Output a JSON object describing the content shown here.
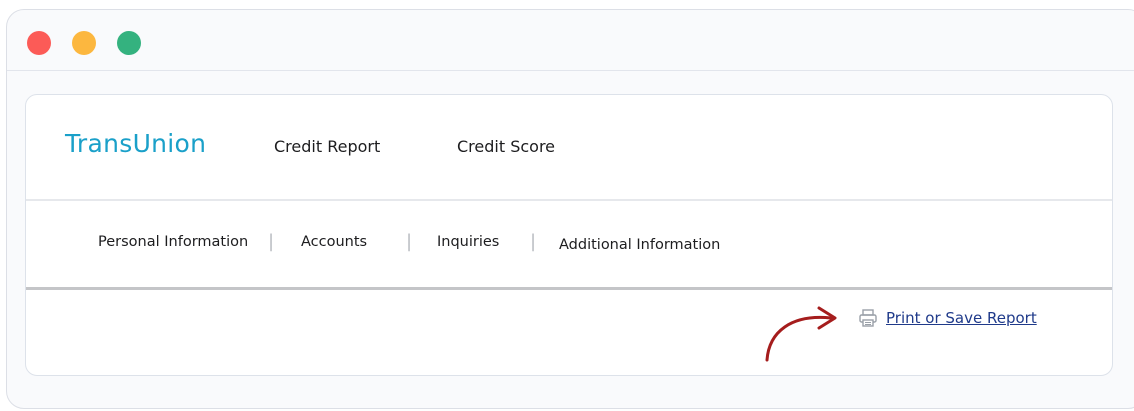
{
  "window": {
    "controls": [
      "close",
      "minimize",
      "maximize"
    ]
  },
  "colors": {
    "close_dot": "#fc5b57",
    "minimize_dot": "#fcb73f",
    "maximize_dot": "#34b27f",
    "brand": "#1aa0c9",
    "link": "#1f3a8a",
    "arrow": "#a51d1d"
  },
  "header": {
    "brand": "TransUnion",
    "nav": [
      {
        "label": "Credit Report"
      },
      {
        "label": "Credit Score"
      }
    ]
  },
  "subnav": {
    "items": [
      {
        "label": "Personal Information"
      },
      {
        "label": "Accounts"
      },
      {
        "label": "Inquiries"
      },
      {
        "label": "Additional Information"
      }
    ],
    "separator": "|"
  },
  "actions": {
    "print_label": "Print or Save Report",
    "print_icon": "printer-icon",
    "arrow_icon": "curved-arrow-icon"
  }
}
